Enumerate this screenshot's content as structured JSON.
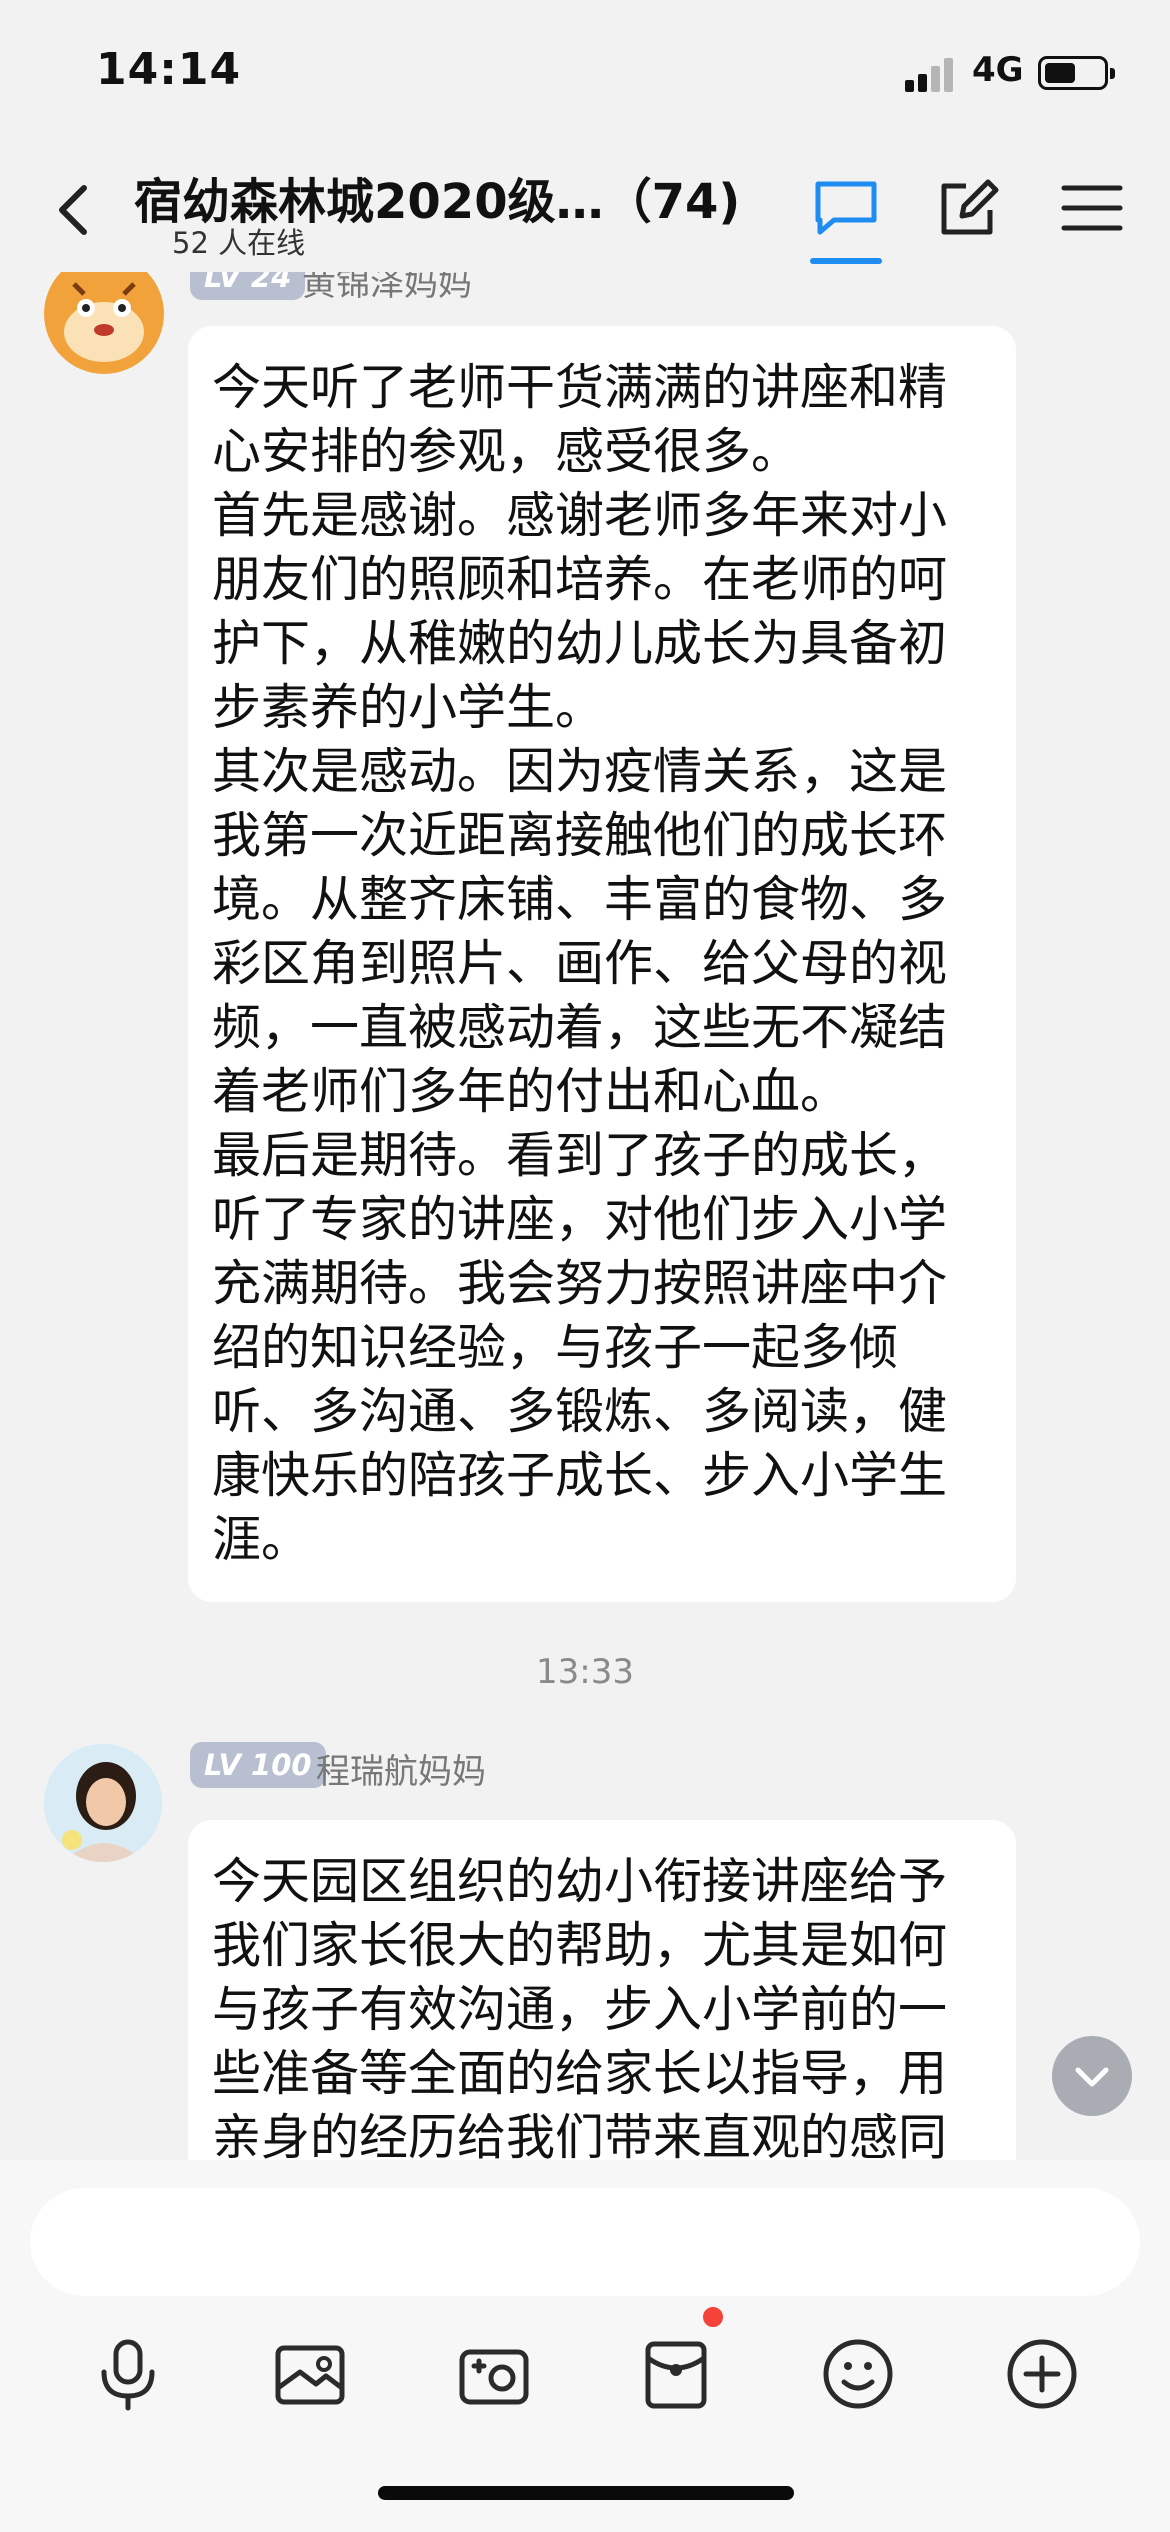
{
  "status_bar": {
    "time": "14:14",
    "network": "4G",
    "icons": [
      "signal-icon",
      "battery-icon"
    ]
  },
  "header": {
    "title": "宿幼森林城2020级…（74)",
    "online": "52 人在线",
    "icons": [
      "back-icon",
      "chat-bubble-icon",
      "edit-icon",
      "menu-icon"
    ],
    "accent_color": "#1e8cf0"
  },
  "messages": [
    {
      "level": "LV 24",
      "sender": "黄锦泽妈妈",
      "avatar": "tiger-cartoon-avatar",
      "text": "今天听了老师干货满满的讲座和精心安排的参观，感受很多。\n首先是感谢。感谢老师多年来对小朋友们的照顾和培养。在老师的呵护下，从稚嫩的幼儿成长为具备初步素养的小学生。\n其次是感动。因为疫情关系，这是我第一次近距离接触他们的成长环境。从整齐床铺、丰富的食物、多彩区角到照片、画作、给父母的视频，一直被感动着，这些无不凝结着老师们多年的付出和心血。\n最后是期待。看到了孩子的成长，听了专家的讲座，对他们步入小学充满期待。我会努力按照讲座中介绍的知识经验，与孩子一起多倾听、多沟通、多锻炼、多阅读，健康快乐的陪孩子成长、步入小学生涯。"
    },
    {
      "level": "LV 100",
      "sender": "程瑞航妈妈",
      "avatar": "woman-photo-avatar",
      "text": "今天园区组织的幼小衔接讲座给予我们家长很大的帮助，尤其是如何与孩子有效沟通，步入小学前的一些准备等全面的给家长以指导，用亲身的经历给我们带来直观的感同"
    }
  ],
  "timestamp": "13:33",
  "input": {
    "placeholder": ""
  },
  "toolbar": {
    "icons": [
      "microphone-icon",
      "image-icon",
      "camera-icon",
      "red-packet-icon",
      "emoji-icon",
      "plus-icon"
    ],
    "notification_dot_color": "#f5433a"
  }
}
